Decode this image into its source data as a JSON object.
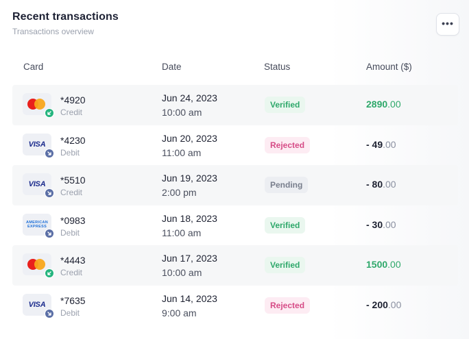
{
  "header": {
    "title": "Recent transactions",
    "subtitle": "Transactions overview",
    "more_icon": "more-horizontal-icon",
    "more_label": "•••"
  },
  "columns": [
    "Card",
    "Date",
    "Status",
    "Amount ($)"
  ],
  "colors": {
    "verified": "#2ea86a",
    "rejected": "#d64b86",
    "pending": "#787e8c"
  },
  "transactions": [
    {
      "brand": "mastercard",
      "direction": "incoming",
      "number": "*4920",
      "type": "Credit",
      "date": "Jun 24, 2023",
      "time": "10:00 am",
      "status": "Verified",
      "amount_whole": "2890",
      "amount_dec": ".00",
      "positive": true
    },
    {
      "brand": "visa",
      "brand_label": "VISA",
      "direction": "outgoing",
      "number": "*4230",
      "type": "Debit",
      "date": "Jun 20, 2023",
      "time": "11:00 am",
      "status": "Rejected",
      "amount_whole": "- 49",
      "amount_dec": ".00",
      "positive": false
    },
    {
      "brand": "visa",
      "brand_label": "VISA",
      "direction": "outgoing",
      "number": "*5510",
      "type": "Credit",
      "date": "Jun 19, 2023",
      "time": "2:00 pm",
      "status": "Pending",
      "amount_whole": "- 80",
      "amount_dec": ".00",
      "positive": false
    },
    {
      "brand": "amex",
      "brand_label": "AMERICAN EXPRESS",
      "direction": "outgoing",
      "number": "*0983",
      "type": "Debit",
      "date": "Jun 18, 2023",
      "time": "11:00 am",
      "status": "Verified",
      "amount_whole": "- 30",
      "amount_dec": ".00",
      "positive": false
    },
    {
      "brand": "mastercard",
      "direction": "incoming",
      "number": "*4443",
      "type": "Credit",
      "date": "Jun 17, 2023",
      "time": "10:00 am",
      "status": "Verified",
      "amount_whole": "1500",
      "amount_dec": ".00",
      "positive": true
    },
    {
      "brand": "visa",
      "brand_label": "VISA",
      "direction": "outgoing",
      "number": "*7635",
      "type": "Debit",
      "date": "Jun 14, 2023",
      "time": "9:00 am",
      "status": "Rejected",
      "amount_whole": "- 200",
      "amount_dec": ".00",
      "positive": false
    }
  ]
}
